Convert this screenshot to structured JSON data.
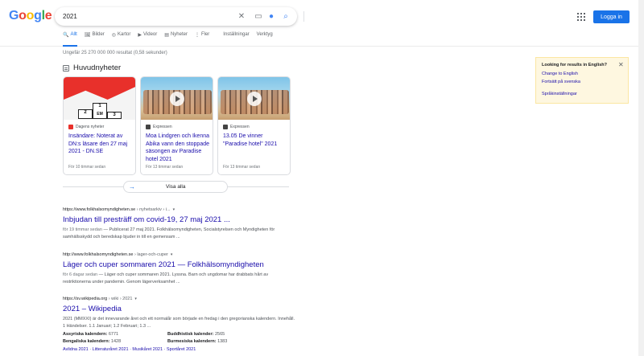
{
  "header": {
    "logo_letters": [
      {
        "ch": "G",
        "color": "#4285f4"
      },
      {
        "ch": "o",
        "color": "#ea4335"
      },
      {
        "ch": "o",
        "color": "#fbbc05"
      },
      {
        "ch": "g",
        "color": "#4285f4"
      },
      {
        "ch": "l",
        "color": "#34a853"
      },
      {
        "ch": "e",
        "color": "#ea4335"
      }
    ],
    "search_value": "2021",
    "login_label": "Logga in"
  },
  "tabs": [
    {
      "icon": "🔍",
      "label": "Allt"
    },
    {
      "icon": "🖼",
      "label": "Bilder"
    },
    {
      "icon": "◎",
      "label": "Kartor"
    },
    {
      "icon": "▶",
      "label": "Videor"
    },
    {
      "icon": "▤",
      "label": "Nyheter"
    },
    {
      "icon": "⋮",
      "label": "Fler"
    }
  ],
  "tools": {
    "settings": "Inställningar",
    "tools": "Verktyg"
  },
  "stats": "Ungefär 25 270 000 000 resultat (0,58 sekunder)",
  "news": {
    "heading": "Huvudnyheter",
    "cards": [
      {
        "source": "Dagens nyheter",
        "source_color": "#e8302b",
        "title": "Insändare: Noterat av DN:s läsare den 27 maj 2021 - DN.SE",
        "time": "För 10 timmar sedan"
      },
      {
        "source": "Expressen",
        "source_color": "#444444",
        "title": "Moa Lindgren och Ikenna Abika vann den stoppade säsongen av Paradise hotel 2021",
        "time": "För 13 timmar sedan"
      },
      {
        "source": "Expressen",
        "source_color": "#444444",
        "title": "13.05 De vinner \"Paradise hotel\" 2021",
        "time": "För 13 timmar sedan"
      }
    ],
    "show_all": "Visa alla",
    "podium_labels": [
      "2",
      "1",
      "EM",
      "3"
    ]
  },
  "results": [
    {
      "url": "https://www.folkhalsomyndigheten.se",
      "path": " › nyhetsarkiv › i...",
      "title": "Inbjudan till presträff om covid-19, 27 maj 2021 ...",
      "date": "för 19 timmar sedan",
      "snippet": " — Publicerat 27 maj 2021. Folkhälsomyndigheten, Socialstyrelsen och Myndigheten för samhällsskydd och beredskap bjuder in till en gemensam ..."
    },
    {
      "url": "http://www.folkhalsomyndigheten.se",
      "path": " › lager-och-cuper",
      "title": "Läger och cuper sommaren 2021 — Folkhälsomyndigheten",
      "date": "för 6 dagar sedan",
      "snippet": " — Läger och cuper sommaren 2021. Lyssna. Barn och ungdomar har drabbats hårt av restriktionerna under pandemin. Genom lägerverksamhet ..."
    },
    {
      "url": "https://sv.wikipedia.org",
      "path": " › wiki › 2021",
      "title": "2021 – Wikipedia",
      "snippet": "2021 (MMXXI) är det innevarande året och ett normalår som började en fredag i den gregorianska kalendern. Innehåll. 1 Händelser. 1.1 Januari; 1.2 Februari; 1.3 ...",
      "facts": [
        {
          "k": "Assyriska kalendern:",
          "v": "6771"
        },
        {
          "k": "Buddhistisk kalender:",
          "v": "2565"
        },
        {
          "k": "Bengaliska kalendern:",
          "v": "1428"
        },
        {
          "k": "Burmesiska kalendern:",
          "v": "1383"
        }
      ],
      "sitelinks": "Avlidna 2021 · Litteraturåret 2021 · Musikåret 2021 · Sportåret 2021"
    }
  ],
  "lang_panel": {
    "title": "Looking for results in English?",
    "change": "Change to English",
    "continue": "Fortsätt på svenska",
    "settings": "Språkinställningar"
  }
}
